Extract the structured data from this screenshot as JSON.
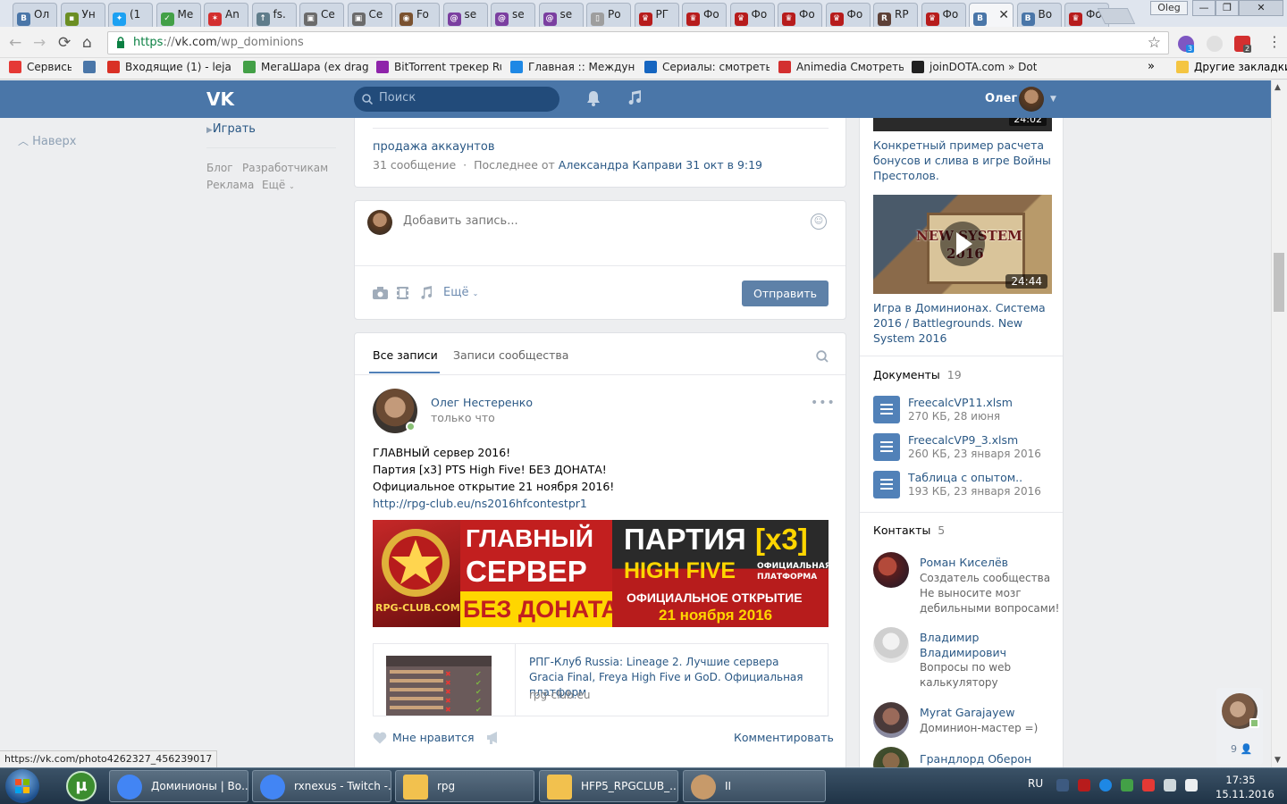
{
  "browser": {
    "tabs": [
      {
        "label": "Ол",
        "color": "#4a76a8",
        "glyph": "В"
      },
      {
        "label": "Ун",
        "color": "#6b8e23",
        "glyph": "▪"
      },
      {
        "label": "(1",
        "color": "#1da1f2",
        "glyph": "✦"
      },
      {
        "label": "Ме",
        "color": "#43a047",
        "glyph": "✓"
      },
      {
        "label": "An",
        "color": "#d32f2f",
        "glyph": "✶"
      },
      {
        "label": "fs.",
        "color": "#607d8b",
        "glyph": "↑"
      },
      {
        "label": "Се",
        "color": "#6b6b6b",
        "glyph": "▣"
      },
      {
        "label": "Се",
        "color": "#6b6b6b",
        "glyph": "▣"
      },
      {
        "label": "Fo",
        "color": "#7a5230",
        "glyph": "◉"
      },
      {
        "label": "se",
        "color": "#7b3fa0",
        "glyph": "@"
      },
      {
        "label": "se",
        "color": "#7b3fa0",
        "glyph": "@"
      },
      {
        "label": "se",
        "color": "#7b3fa0",
        "glyph": "@"
      },
      {
        "label": "Ро",
        "color": "#9e9e9e",
        "glyph": "▯"
      },
      {
        "label": "РГ",
        "color": "#b71c1c",
        "glyph": "♛"
      },
      {
        "label": "Фо",
        "color": "#b71c1c",
        "glyph": "♛"
      },
      {
        "label": "Фо",
        "color": "#b71c1c",
        "glyph": "♛"
      },
      {
        "label": "Фо",
        "color": "#b71c1c",
        "glyph": "♛"
      },
      {
        "label": "Фо",
        "color": "#b71c1c",
        "glyph": "♛"
      },
      {
        "label": "RP",
        "color": "#5d4037",
        "glyph": "R"
      },
      {
        "label": "Фо",
        "color": "#b71c1c",
        "glyph": "♛"
      },
      {
        "label": "",
        "color": "#4a76a8",
        "glyph": "В",
        "active": true
      },
      {
        "label": "Во",
        "color": "#4a76a8",
        "glyph": "В"
      },
      {
        "label": "Фо",
        "color": "#b71c1c",
        "glyph": "♛"
      }
    ],
    "tab_close": "✕",
    "profile_name": "Oleg",
    "window_buttons": {
      "minimize": "—",
      "maximize": "❐",
      "close": "✕"
    },
    "url_scheme": "https",
    "url_host": "vk.com",
    "url_path": "/wp_dominions",
    "ext_badges": {
      "first": "3",
      "second": "2"
    },
    "bookmarks": [
      {
        "label": "Сервисы",
        "color": "#e53935"
      },
      {
        "label": "",
        "color": "#4a76a8"
      },
      {
        "label": "Входящие (1) - lejalim",
        "color": "#d93025"
      },
      {
        "label": "МегаШара (ex dragm",
        "color": "#43a047"
      },
      {
        "label": "BitTorrent трекер RuT",
        "color": "#8e24aa"
      },
      {
        "label": "Главная :: Междунар",
        "color": "#1e88e5"
      },
      {
        "label": "Сериалы: смотреть о",
        "color": "#1565c0"
      },
      {
        "label": "Animedia Смотреть А",
        "color": "#d32f2f"
      },
      {
        "label": "joinDOTA.com » Dota",
        "color": "#212121"
      }
    ],
    "bookmarks_more": "»",
    "other_bookmarks": "Другие закладки",
    "status_url": "https://vk.com/photo4262327_456239017"
  },
  "vk": {
    "logo": "VK",
    "search_placeholder": "Поиск",
    "user_name": "Олег",
    "left_nav": {
      "back_to_top": "Наверх",
      "play": "Играть",
      "footer": [
        "Блог",
        "Разработчикам",
        "Реклама",
        "Ещё"
      ]
    },
    "topic": {
      "title": "продажа аккаунтов",
      "count": "31 сообщение",
      "last_prefix": "Последнее от",
      "last_author": "Александра Каправи",
      "last_time": "31 окт в 9:19"
    },
    "composer": {
      "placeholder": "Добавить запись...",
      "more": "Ещё",
      "submit": "Отправить"
    },
    "wall_tabs": [
      "Все записи",
      "Записи сообщества"
    ],
    "post": {
      "author": "Олег Нестеренко",
      "time": "только что",
      "lines": [
        "ГЛАВНЫЙ сервер 2016!",
        "Партия [x3] PTS High Five! БЕЗ ДОНАТА!",
        "Официальное открытие 21 ноября 2016!"
      ],
      "link": "http://rpg-club.eu/ns2016hfcontestpr1",
      "banner": {
        "site": "RPG-CLUB.COM",
        "main_1": "ГЛАВНЫЙ",
        "main_2": "СЕРВЕР",
        "main_3": "БЕЗ ДОНАТА",
        "party": "ПАРТИЯ",
        "x3": "[x3]",
        "hf": "HIGH FIVE",
        "official_1": "ОФИЦИАЛЬНАЯ",
        "official_2": "ПЛАТФОРМА",
        "opening": "ОФИЦИАЛЬНОЕ ОТКРЫТИЕ",
        "date": "21 ноября 2016"
      },
      "snippet": {
        "title": "РПГ-Клуб Russia: Lineage 2. Лучшие сервера Gracia Final, Freya High Five и GoD. Официальная платформ",
        "domain": "rpg-club.eu"
      },
      "like": "Мне нравится",
      "comment": "Комментировать"
    },
    "right": {
      "top_video_duration": "24:02",
      "top_video_caption": "Конкретный пример расчета бонусов и слива в игре Войны Престолов.",
      "video": {
        "overlay_1": "NEW SYSTEM",
        "overlay_2": "2016",
        "duration": "24:44",
        "caption": "Игра в Доминионах. Система 2016 / Battlegrounds. New System 2016"
      },
      "docs_title": "Документы",
      "docs_count": "19",
      "docs": [
        {
          "name": "FreecalcVP11.xlsm",
          "meta": "270 КБ, 28 июня"
        },
        {
          "name": "FreecalcVP9_3.xlsm",
          "meta": "260 КБ, 23 января 2016"
        },
        {
          "name": "Таблица с опытом..",
          "meta": "193 КБ, 23 января 2016"
        }
      ],
      "contacts_title": "Контакты",
      "contacts_count": "5",
      "contacts": [
        {
          "name": "Роман Киселёв",
          "role_1": "Создатель сообщества",
          "role_2": "Не выносите мозг",
          "role_3": "дебильными вопросами!"
        },
        {
          "name": "Владимир",
          "name_2": "Владимирович",
          "role_1": "Вопросы по web",
          "role_2": "калькулятору"
        },
        {
          "name": "Myrat Garajayew",
          "role_1": "Доминион-мастер =)"
        },
        {
          "name": "Грандлорд Оберон"
        }
      ],
      "online_count": "9"
    }
  },
  "taskbar": {
    "items": [
      {
        "label": "Доминионы | Во...",
        "color": "#4285f4"
      },
      {
        "label": "rxnexus - Twitch -...",
        "color": "#4285f4"
      },
      {
        "label": "rpg",
        "color": "#f2c14e"
      },
      {
        "label": "HFP5_RPGCLUB_...",
        "color": "#f2c14e"
      },
      {
        "label": "II",
        "color": "#c79a6a"
      }
    ],
    "lang": "RU",
    "time": "17:35",
    "date": "15.11.2016"
  }
}
